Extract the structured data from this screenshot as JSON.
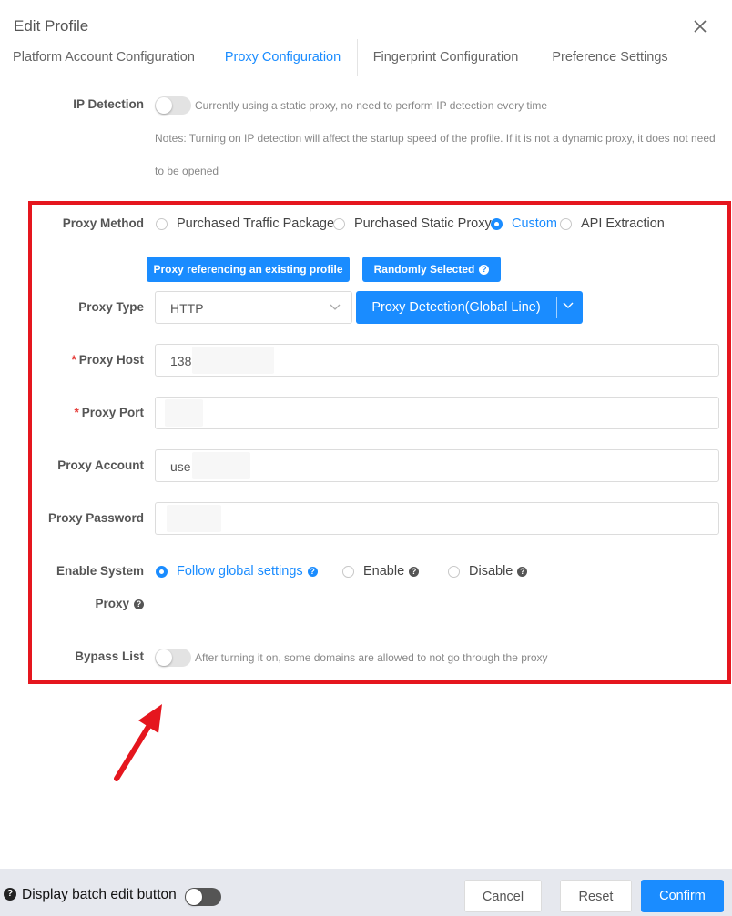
{
  "dialog": {
    "title": "Edit Profile"
  },
  "tabs": [
    {
      "label": "Platform Account Configuration"
    },
    {
      "label": "Proxy Configuration"
    },
    {
      "label": "Fingerprint Configuration"
    },
    {
      "label": "Preference Settings"
    }
  ],
  "ip_detection": {
    "label": "IP Detection",
    "hint": "Currently using a static proxy, no need to perform IP detection every time",
    "note_line1": "Notes: Turning on IP detection will affect the startup speed of the profile. If it is not a dynamic proxy, it does not need",
    "note_line2": "to be opened"
  },
  "proxy_method": {
    "label": "Proxy Method",
    "options": [
      {
        "label": "Purchased Traffic Package"
      },
      {
        "label": "Purchased Static Proxy"
      },
      {
        "label": "Custom"
      },
      {
        "label": "API Extraction"
      }
    ],
    "selected": "Custom"
  },
  "actions": {
    "reference_profile": "Proxy referencing an existing profile",
    "random": "Randomly Selected"
  },
  "proxy_type": {
    "label": "Proxy Type",
    "value": "HTTP",
    "detect_button": "Proxy Detection(Global Line)"
  },
  "proxy_host": {
    "label": "Proxy Host",
    "value": "138"
  },
  "proxy_port": {
    "label": "Proxy Port",
    "value": ""
  },
  "proxy_account": {
    "label": "Proxy Account",
    "value": "use"
  },
  "proxy_password": {
    "label": "Proxy Password",
    "value": ""
  },
  "system_proxy": {
    "label_line1": "Enable System",
    "label_line2": "Proxy",
    "options": [
      {
        "label": "Follow global settings"
      },
      {
        "label": "Enable"
      },
      {
        "label": "Disable"
      }
    ],
    "selected": "Follow global settings"
  },
  "bypass": {
    "label": "Bypass List",
    "hint": "After turning it on, some domains are allowed to not go through the proxy"
  },
  "footer": {
    "batch_label": "Display batch edit button",
    "cancel": "Cancel",
    "reset": "Reset",
    "confirm": "Confirm"
  },
  "colors": {
    "accent": "#1a8cff",
    "highlight_box": "#e5161e",
    "required": "#e53935"
  }
}
